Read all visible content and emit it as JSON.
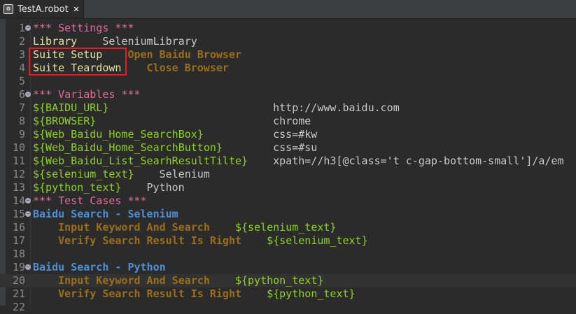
{
  "tab": {
    "title": "TestA.robot",
    "close": "✕"
  },
  "lines": [
    {
      "n": "1",
      "fold": true,
      "tokens": [
        {
          "t": "*** Settings ***",
          "c": "sec",
          "col": 0
        }
      ]
    },
    {
      "n": "2",
      "tokens": [
        {
          "t": "Library",
          "c": "set",
          "col": 0
        },
        {
          "t": "SeleniumLibrary",
          "c": "val",
          "col": 11
        }
      ]
    },
    {
      "n": "3",
      "tokens": [
        {
          "t": "Suite Setup",
          "c": "set",
          "col": 0
        },
        {
          "t": "Open Baidu Browser",
          "c": "kw",
          "col": 15
        }
      ]
    },
    {
      "n": "4",
      "tokens": [
        {
          "t": "Suite Teardown",
          "c": "set",
          "col": 0
        },
        {
          "t": "Close Browser",
          "c": "kw",
          "col": 18
        }
      ]
    },
    {
      "n": "5",
      "tokens": []
    },
    {
      "n": "6",
      "fold": true,
      "tokens": [
        {
          "t": "*** Variables ***",
          "c": "sec",
          "col": 0
        }
      ]
    },
    {
      "n": "7",
      "tokens": [
        {
          "t": "${BAIDU_URL}",
          "c": "var",
          "col": 0
        },
        {
          "t": "http://www.baidu.com",
          "c": "val",
          "col": 38
        }
      ]
    },
    {
      "n": "8",
      "tokens": [
        {
          "t": "${BROWSER}",
          "c": "var",
          "col": 0
        },
        {
          "t": "chrome",
          "c": "val",
          "col": 38
        }
      ]
    },
    {
      "n": "9",
      "tokens": [
        {
          "t": "${Web_Baidu_Home_SearchBox}",
          "c": "var",
          "col": 0
        },
        {
          "t": "css=#kw",
          "c": "val",
          "col": 38
        }
      ]
    },
    {
      "n": "10",
      "tokens": [
        {
          "t": "${Web_Baidu_Home_SearchButton}",
          "c": "var",
          "col": 0
        },
        {
          "t": "css=#su",
          "c": "val",
          "col": 38
        }
      ]
    },
    {
      "n": "11",
      "tokens": [
        {
          "t": "${Web_Baidu_List_SearhResultTilte}",
          "c": "var",
          "col": 0
        },
        {
          "t": "xpath=//h3[@class='t c-gap-bottom-small']/a/em",
          "c": "val",
          "col": 38
        }
      ]
    },
    {
      "n": "12",
      "tokens": [
        {
          "t": "${selenium_text}",
          "c": "var",
          "col": 0
        },
        {
          "t": "Selenium",
          "c": "val",
          "col": 20
        }
      ]
    },
    {
      "n": "13",
      "tokens": [
        {
          "t": "${python_text}",
          "c": "var",
          "col": 0
        },
        {
          "t": "Python",
          "c": "val",
          "col": 18
        }
      ]
    },
    {
      "n": "14",
      "fold": true,
      "tokens": [
        {
          "t": "*** Test Cases ***",
          "c": "sec",
          "col": 0
        }
      ]
    },
    {
      "n": "15",
      "fold": true,
      "tokens": [
        {
          "t": "Baidu Search - Selenium",
          "c": "tc",
          "col": 0
        }
      ]
    },
    {
      "n": "16",
      "tokens": [
        {
          "t": "Input Keyword And Search",
          "c": "kw",
          "col": 4
        },
        {
          "t": "${selenium_text}",
          "c": "var",
          "col": 32
        }
      ]
    },
    {
      "n": "17",
      "tokens": [
        {
          "t": "Verify Search Result Is Right",
          "c": "kw",
          "col": 4
        },
        {
          "t": "${selenium_text}",
          "c": "var",
          "col": 37
        }
      ]
    },
    {
      "n": "18",
      "tokens": []
    },
    {
      "n": "19",
      "fold": true,
      "tokens": [
        {
          "t": "Baidu Search - Python",
          "c": "tc",
          "col": 0
        }
      ]
    },
    {
      "n": "20",
      "hl": true,
      "tokens": [
        {
          "t": "Input Keyword And Search",
          "c": "kw",
          "col": 4
        },
        {
          "t": "${python_text}",
          "c": "var",
          "col": 32
        }
      ]
    },
    {
      "n": "21",
      "tokens": [
        {
          "t": "Verify Search Result Is Right",
          "c": "kw",
          "col": 4
        },
        {
          "t": "${python_text}",
          "c": "var",
          "col": 37
        }
      ]
    },
    {
      "n": "22",
      "tokens": []
    }
  ]
}
